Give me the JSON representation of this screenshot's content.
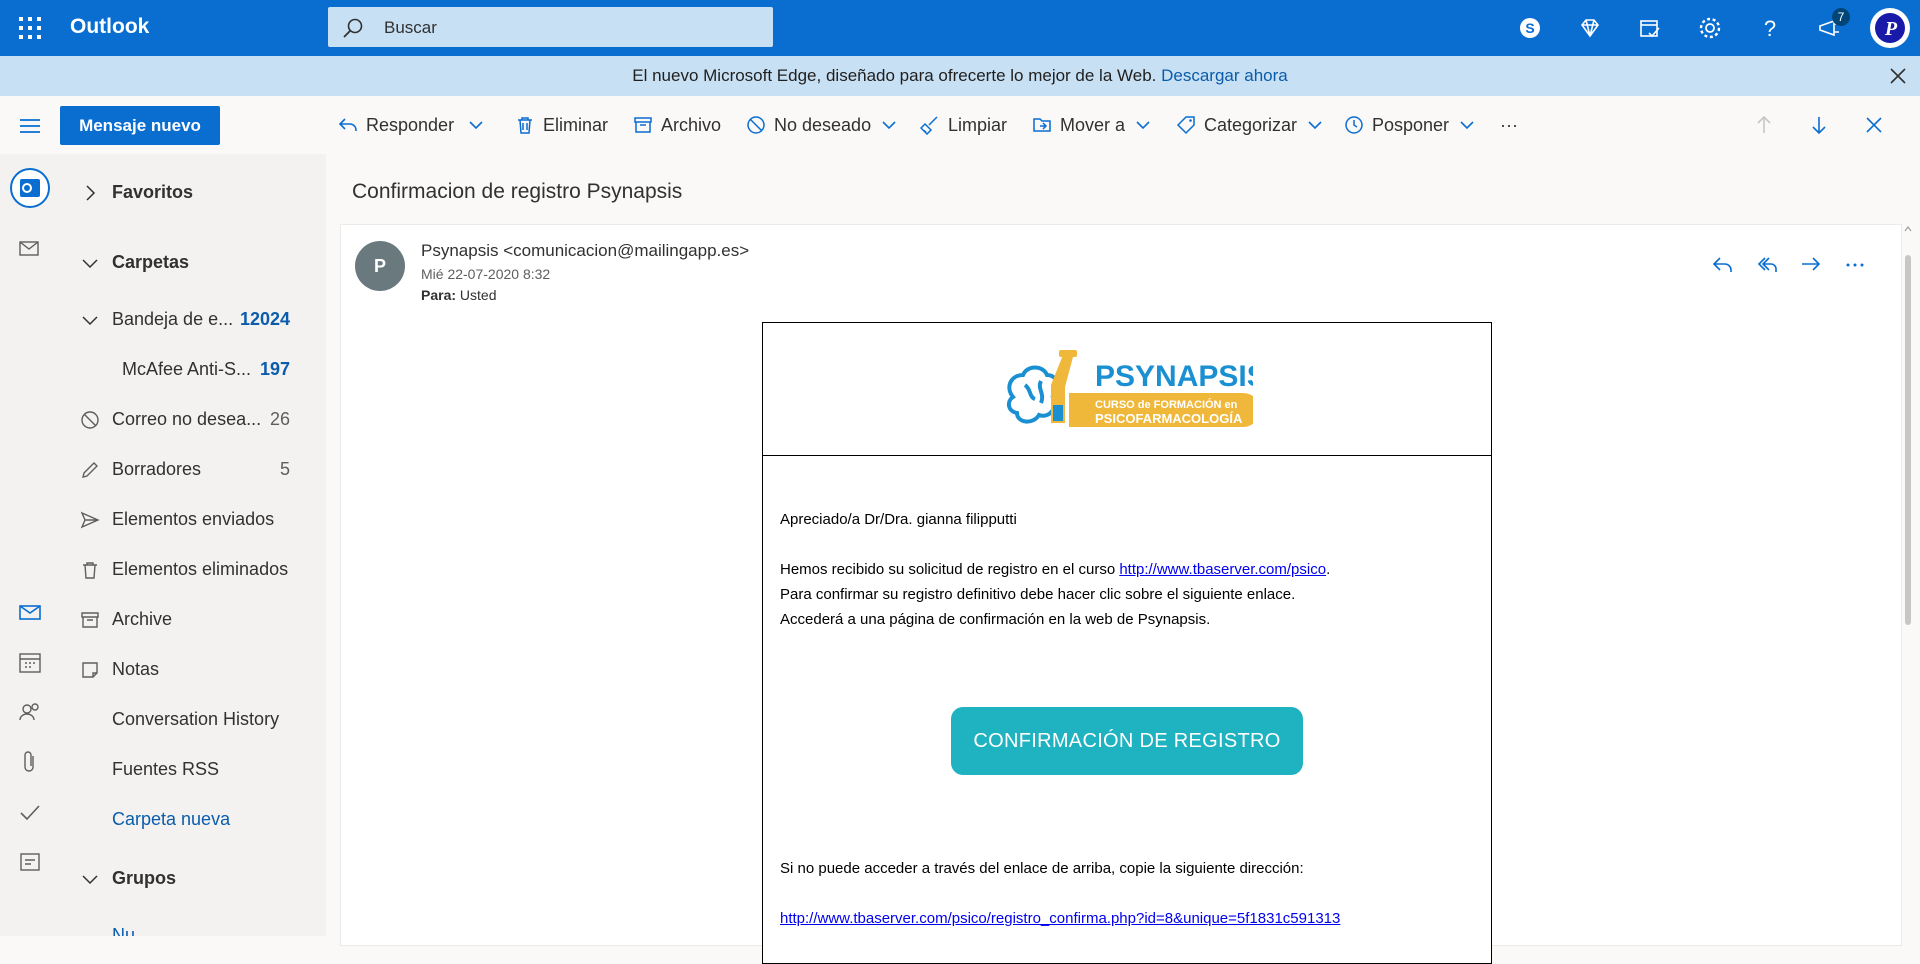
{
  "app": {
    "name": "Outlook"
  },
  "search": {
    "placeholder": "Buscar"
  },
  "header": {
    "notification_count": "7"
  },
  "banner": {
    "text": "El nuevo Microsoft Edge, diseñado para ofrecerte lo mejor de la Web.",
    "link": "Descargar ahora"
  },
  "toolbar": {
    "new_mail": "Mensaje nuevo",
    "reply": "Responder",
    "delete": "Eliminar",
    "archive": "Archivo",
    "junk": "No deseado",
    "sweep": "Limpiar",
    "move": "Mover a",
    "categorize": "Categorizar",
    "snooze": "Posponer",
    "more": "···"
  },
  "folders": {
    "favorites": "Favoritos",
    "folders_header": "Carpetas",
    "items": [
      {
        "label": "Bandeja de e...",
        "count": "12024"
      },
      {
        "label": "McAfee Anti-S...",
        "count": "197"
      },
      {
        "label": "Correo no desea...",
        "count": "26"
      },
      {
        "label": "Borradores",
        "count": "5"
      },
      {
        "label": "Elementos enviados",
        "count": ""
      },
      {
        "label": "Elementos eliminados",
        "count": ""
      },
      {
        "label": "Archive",
        "count": ""
      },
      {
        "label": "Notas",
        "count": ""
      },
      {
        "label": "Conversation History",
        "count": ""
      },
      {
        "label": "Fuentes RSS",
        "count": ""
      },
      {
        "label": "Carpeta nueva",
        "count": ""
      }
    ],
    "groups_header": "Grupos",
    "groups_partial": "Nu..."
  },
  "message": {
    "subject": "Confirmacion de registro Psynapsis",
    "avatar_letter": "P",
    "sender": "Psynapsis <comunicacion@mailingapp.es>",
    "date": "Mié 22-07-2020 8:32",
    "to_label": "Para:",
    "to_value": "Usted",
    "logo_title": "PSYNAPSIS",
    "logo_line1": "CURSO de FORMACIÓN en",
    "logo_line2": "PSICOFARMACOLOGÍA",
    "greeting": "Apreciado/a Dr/Dra. gianna filipputti",
    "line1_pre": "Hemos recibido su solicitud de registro en el curso ",
    "line1_link": "http://www.tbaserver.com/psico",
    "line1_post": ".",
    "line2": "Para confirmar su registro definitivo debe hacer clic sobre el siguiente enlace.",
    "line3": "Accederá a una página de confirmación en la web de Psynapsis.",
    "cta": "CONFIRMACIÓN DE REGISTRO",
    "fallback": "Si no puede acceder a través del enlace de arriba, copie la siguiente dirección:",
    "fallback_link": "http://www.tbaserver.com/psico/registro_confirma.php?id=8&unique=5f1831c591313"
  },
  "colors": {
    "brand": "#0a6ed1",
    "cta": "#1fb2c0",
    "logo_blue": "#1a8fd1",
    "logo_gold": "#f0b83a"
  }
}
